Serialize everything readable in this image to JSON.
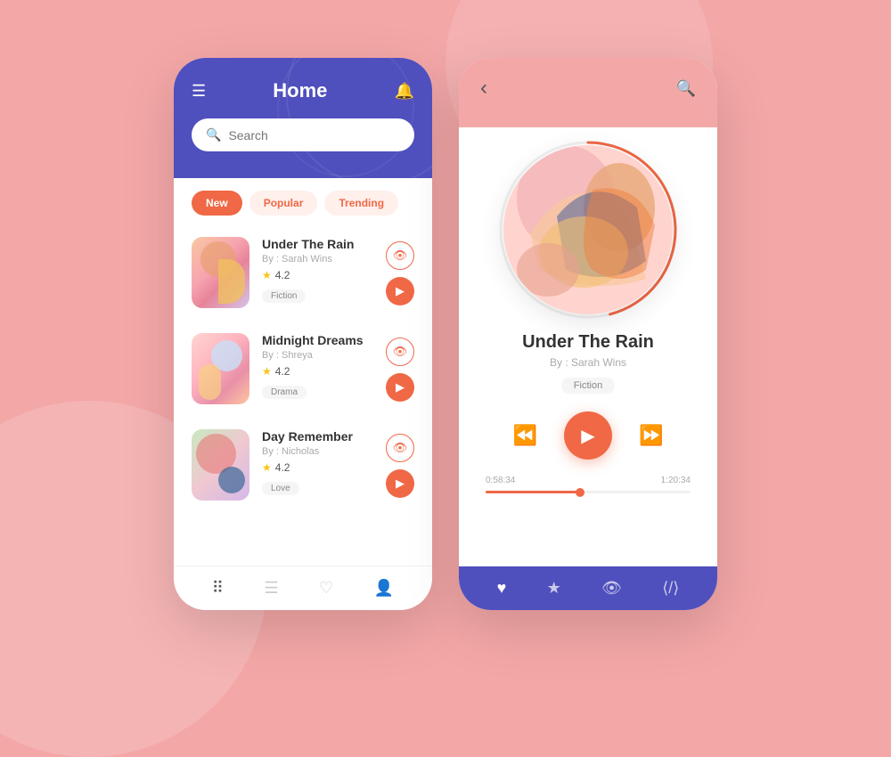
{
  "leftScreen": {
    "header": {
      "title": "Home",
      "menuIcon": "☰",
      "bellIcon": "🔔"
    },
    "search": {
      "placeholder": "Search"
    },
    "filterTabs": [
      {
        "label": "New",
        "active": true
      },
      {
        "label": "Popular",
        "active": false
      },
      {
        "label": "Trending",
        "active": false
      }
    ],
    "books": [
      {
        "title": "Under The Rain",
        "author": "By : Sarah Wins",
        "rating": "4.2",
        "genre": "Fiction",
        "coverClass": "cover-1"
      },
      {
        "title": "Midnight Dreams",
        "author": "By : Shreya",
        "rating": "4.2",
        "genre": "Drama",
        "coverClass": "cover-2"
      },
      {
        "title": "Day Remember",
        "author": "By : Nicholas",
        "rating": "4.2",
        "genre": "Love",
        "coverClass": "cover-3"
      }
    ],
    "bottomNav": [
      {
        "icon": "⠿",
        "active": true
      },
      {
        "icon": "☰",
        "active": false
      },
      {
        "icon": "♡",
        "active": false
      },
      {
        "icon": "👤",
        "active": false
      }
    ]
  },
  "rightScreen": {
    "header": {
      "backIcon": "‹",
      "searchIcon": "🔍"
    },
    "player": {
      "title": "Under The Rain",
      "author": "By : Sarah Wins",
      "genre": "Fiction",
      "currentTime": "0:58:34",
      "totalTime": "1:20:34",
      "progress": 46
    },
    "controls": {
      "rewind": "«",
      "play": "▶",
      "forward": "»"
    },
    "bottomNav": [
      {
        "icon": "♡",
        "active": true
      },
      {
        "icon": "★",
        "active": false
      },
      {
        "icon": "👁",
        "active": false
      },
      {
        "icon": "⟨",
        "active": false
      }
    ]
  },
  "colors": {
    "primary": "#4f4fbd",
    "accent": "#f06845",
    "headerPink": "#f4a7a7",
    "background": "#f4a7a7"
  }
}
